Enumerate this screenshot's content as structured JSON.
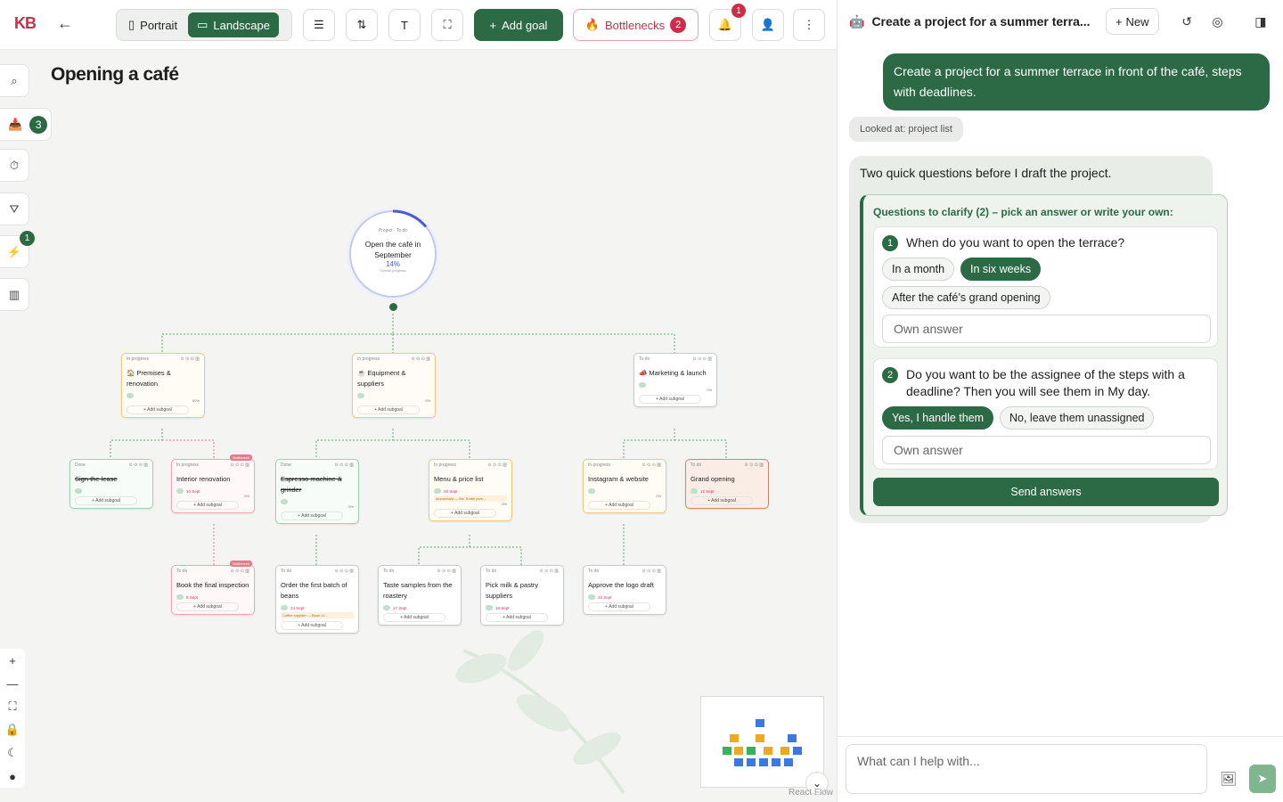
{
  "app": {
    "logo": "KB"
  },
  "toolbar": {
    "portrait": "Portrait",
    "landscape": "Landscape",
    "add_goal": "Add goal",
    "bottlenecks": "Bottlenecks",
    "bottlenecks_count": "2",
    "notifications_count": "1"
  },
  "page": {
    "title": "Opening a café"
  },
  "left_sidebar": {
    "inbox_count": "3",
    "automations_count": "1"
  },
  "canvas": {
    "root": {
      "tag1": "Project",
      "tag2": "To do",
      "title": "Open the café in September",
      "progress": "14%",
      "progress_value": 0.14,
      "sub": "Overall progress"
    },
    "nodes": [
      {
        "status": "In progress",
        "title": "🏠 Premises & renovation",
        "pct": "60%",
        "add": "+ Add subgoal"
      },
      {
        "status": "In progress",
        "title": "☕ Equipment & suppliers",
        "pct": "0%",
        "add": "+ Add subgoal"
      },
      {
        "status": "To do",
        "title": "📣 Marketing & launch",
        "pct": "0%",
        "add": "+ Add subgoal"
      },
      {
        "status": "Done",
        "title": "Sign the lease",
        "add": "+ Add subgoal"
      },
      {
        "status": "In progress",
        "title": "Interior renovation",
        "badge": "Bottleneck",
        "date": "10 Sept",
        "pct": "5%",
        "add": "+ Add subgoal"
      },
      {
        "status": "Done",
        "title": "Espresso machine & grinder",
        "pct": "0%",
        "add": "+ Add subgoal"
      },
      {
        "status": "In progress",
        "title": "Menu & price list",
        "date": "20 Sept",
        "note": "Accountant — Ms. Smith (eve...",
        "pct": "0%",
        "add": "+ Add subgoal"
      },
      {
        "status": "In progress",
        "title": "Instagram & website",
        "pct": "0%",
        "add": "+ Add subgoal"
      },
      {
        "status": "To do",
        "title": "Grand opening",
        "date": "12 Sept",
        "add": "+ Add subgoal"
      },
      {
        "status": "To do",
        "title": "Book the final inspection",
        "badge": "Bottleneck",
        "date": "8 Sept",
        "add": "+ Add subgoal"
      },
      {
        "status": "To do",
        "title": "Order the first batch of beans",
        "date": "24 Sept",
        "note": "Coffee supplier — Bean Lt...",
        "add": "+ Add subgoal"
      },
      {
        "status": "To do",
        "title": "Taste samples from the roastery",
        "date": "17 Sept",
        "add": "+ Add subgoal"
      },
      {
        "status": "To do",
        "title": "Pick milk & pastry suppliers",
        "date": "18 Sept",
        "add": "+ Add subgoal"
      },
      {
        "status": "To do",
        "title": "Approve the logo draft",
        "date": "22 Sept",
        "add": "+ Add subgoal"
      }
    ],
    "attribution": "React Flow"
  },
  "chat": {
    "title": "Create a project for a summer terra...",
    "new_label": "New",
    "user_message": "Create a project for a summer terrace in front of the café, steps with deadlines.",
    "looked_at": "Looked at: project list",
    "assistant_intro": "Two quick questions before I draft the project.",
    "questions_header": "Questions to clarify (2) – pick an answer or write your own:",
    "q1": {
      "num": "1",
      "text": "When do you want to open the terrace?",
      "options": [
        "In a month",
        "In six weeks",
        "After the café’s grand opening"
      ],
      "selected": "In six weeks",
      "own_placeholder": "Own answer"
    },
    "q2": {
      "num": "2",
      "text": "Do you want to be the assignee of the steps with a deadline? Then you will see them in My day.",
      "options": [
        "Yes, I handle them",
        "No, leave them unassigned"
      ],
      "selected": "Yes, I handle them",
      "own_placeholder": "Own answer"
    },
    "send_label": "Send answers",
    "composer_placeholder": "What can I help with..."
  }
}
